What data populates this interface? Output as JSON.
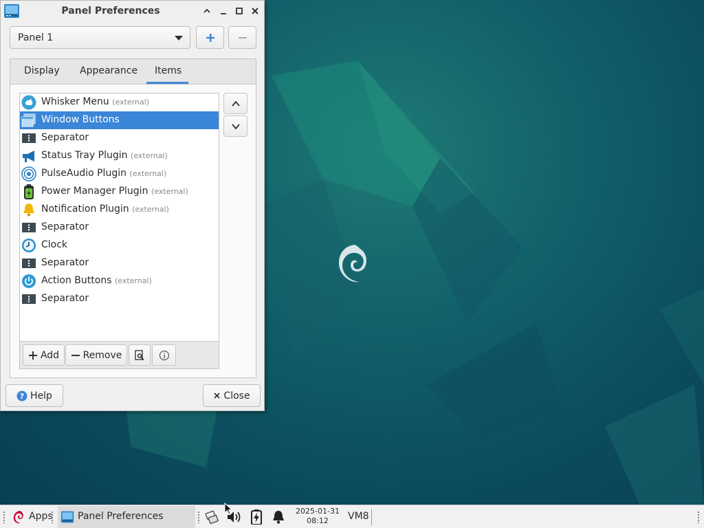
{
  "window": {
    "title": "Panel Preferences"
  },
  "panel_selector": {
    "value": "Panel 1"
  },
  "tabs": [
    "Display",
    "Appearance",
    "Items"
  ],
  "active_tab": "Items",
  "items": [
    {
      "name": "Whisker Menu",
      "suffix": "(external)",
      "icon": "whisker-menu-icon"
    },
    {
      "name": "Window Buttons",
      "suffix": "",
      "icon": "window-buttons-icon",
      "selected": true
    },
    {
      "name": "Separator",
      "suffix": "",
      "icon": "separator-icon"
    },
    {
      "name": "Status Tray Plugin",
      "suffix": "(external)",
      "icon": "megaphone-icon"
    },
    {
      "name": "PulseAudio Plugin",
      "suffix": "(external)",
      "icon": "audio-icon"
    },
    {
      "name": "Power Manager Plugin",
      "suffix": "(external)",
      "icon": "battery-icon"
    },
    {
      "name": "Notification Plugin",
      "suffix": "(external)",
      "icon": "bell-icon"
    },
    {
      "name": "Separator",
      "suffix": "",
      "icon": "separator-icon"
    },
    {
      "name": "Clock",
      "suffix": "",
      "icon": "clock-icon"
    },
    {
      "name": "Separator",
      "suffix": "",
      "icon": "separator-icon"
    },
    {
      "name": "Action Buttons",
      "suffix": "(external)",
      "icon": "power-icon"
    },
    {
      "name": "Separator",
      "suffix": "",
      "icon": "separator-icon"
    }
  ],
  "toolbar": {
    "add_label": "Add",
    "remove_label": "Remove"
  },
  "footer": {
    "help_label": "Help",
    "close_label": "Close"
  },
  "taskbar": {
    "apps_label": "Apps",
    "task_label": "Panel Preferences",
    "date": "2025-01-31",
    "time": "08:12",
    "workspace": "VM8"
  },
  "colors": {
    "accent": "#3b86d8",
    "desktop": "#0f4f5e"
  }
}
